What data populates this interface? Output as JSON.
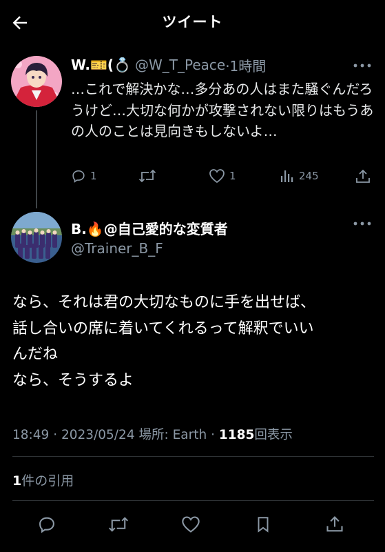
{
  "header": {
    "title": "ツイート"
  },
  "quoted_tweet": {
    "name": "W.🎫(💍",
    "handle": "@W_T_Peace",
    "time": "·1時間",
    "text": "…これで解決かな…多分あの人はまた騒ぐんだろうけど…大切な何かが攻撃されない限りはもうあの人のことは見向きもしないよ…",
    "stats": {
      "replies": "1",
      "retweets": "",
      "likes": "1",
      "views": "245"
    }
  },
  "main_tweet": {
    "name": "B.🔥@自己愛的な変質者",
    "handle": "@Trainer_B_F",
    "text_lines": [
      "なら、それは君の大切なものに手を出せば、",
      "話し合いの席に着いてくれるって解釈でいい",
      "んだね",
      "なら、そうするよ"
    ],
    "timestamp": "18:49 · 2023/05/24 場所: Earth · ",
    "view_count": "1185",
    "view_label": "回表示"
  },
  "quotes": {
    "count": "1",
    "label": "件の引用"
  },
  "colors": {
    "background": "#000000",
    "text": "#e7e9ea",
    "muted": "#8b98a5",
    "divider": "#2f3336"
  },
  "icons": [
    "back-arrow-icon",
    "more-icon",
    "reply-icon",
    "retweet-icon",
    "like-icon",
    "views-icon",
    "share-icon",
    "bookmark-icon"
  ]
}
